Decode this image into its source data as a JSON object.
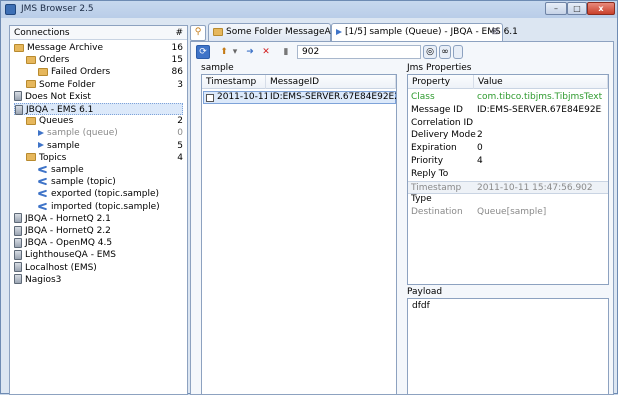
{
  "window": {
    "title": "JMS Browser 2.5",
    "minimize": "–",
    "maximize": "□",
    "close": "x"
  },
  "connections": {
    "header": "Connections",
    "count_header": "#",
    "items": [
      {
        "label": "Message Archive",
        "count": "16"
      },
      {
        "label": "Orders",
        "count": "15"
      },
      {
        "label": "Failed Orders",
        "count": "86"
      },
      {
        "label": "Some Folder",
        "count": "3"
      },
      {
        "label": "Does Not Exist",
        "count": ""
      },
      {
        "label": "JBQA - EMS 6.1",
        "count": ""
      },
      {
        "label": "Queues",
        "count": "2"
      },
      {
        "label": "sample (queue)",
        "count": "0"
      },
      {
        "label": "sample",
        "count": "5"
      },
      {
        "label": "Topics",
        "count": "4"
      },
      {
        "label": "sample",
        "count": ""
      },
      {
        "label": "sample (topic)",
        "count": ""
      },
      {
        "label": "exported (topic.sample)",
        "count": ""
      },
      {
        "label": "imported (topic.sample)",
        "count": ""
      },
      {
        "label": "JBQA - HornetQ 2.1",
        "count": ""
      },
      {
        "label": "JBQA - HornetQ 2.2",
        "count": ""
      },
      {
        "label": "JBQA - OpenMQ 4.5",
        "count": ""
      },
      {
        "label": "LighthouseQA - EMS",
        "count": ""
      },
      {
        "label": "Localhost (EMS)",
        "count": ""
      },
      {
        "label": "Nagios3",
        "count": ""
      }
    ]
  },
  "tabs": [
    {
      "label": "Some Folder MessageArchive"
    },
    {
      "label": "[1/5] sample (Queue) - JBQA - EMS 6.1",
      "close": "⊠"
    }
  ],
  "toolbar": {
    "filter_value": "902"
  },
  "messages": {
    "title": "sample",
    "columns": [
      "Timestamp",
      "MessageID"
    ],
    "rows": [
      {
        "timestamp": "2011-10-11 ...",
        "message_id": "ID:EMS-SERVER.67E84E92E21025..."
      }
    ]
  },
  "properties": {
    "title": "Jms Properties",
    "columns": [
      "Property",
      "Value"
    ],
    "rows": [
      {
        "key": "Class",
        "value": "com.tibco.tibjms.TibjmsTextMe..."
      },
      {
        "key": "Message ID",
        "value": "ID:EMS-SERVER.67E84E92E21025..."
      },
      {
        "key": "Correlation ID",
        "value": ""
      },
      {
        "key": "Delivery Mode",
        "value": "2"
      },
      {
        "key": "Expiration",
        "value": "0"
      },
      {
        "key": "Priority",
        "value": "4"
      },
      {
        "key": "Reply To",
        "value": ""
      },
      {
        "key": "Timestamp",
        "value": "2011-10-11 15:47:56.902"
      },
      {
        "key": "Type",
        "value": ""
      },
      {
        "key": "Destination",
        "value": "Queue[sample]"
      }
    ]
  },
  "payload": {
    "title": "Payload",
    "content": "dfdf"
  }
}
